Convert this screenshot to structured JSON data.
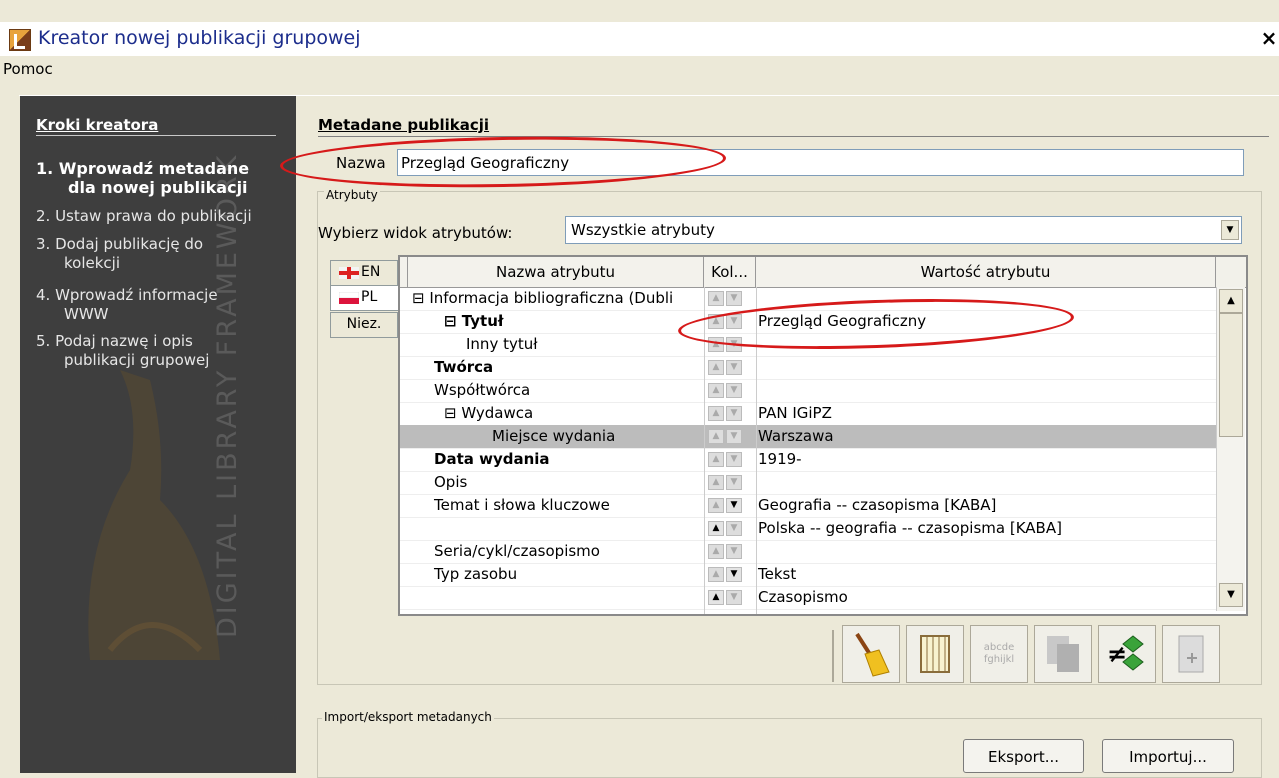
{
  "window": {
    "title": "Kreator nowej publikacji grupowej",
    "close_symbol": "×"
  },
  "menu": {
    "help": "Pomoc"
  },
  "sidebar": {
    "title": "Kroki kreatora",
    "steps": [
      {
        "line1": "1. Wprowadź metadane",
        "line2": "dla nowej publikacji"
      },
      {
        "line1": "2. Ustaw prawa do publikacji",
        "line2": ""
      },
      {
        "line1": "3. Dodaj publikację do",
        "line2": "kolekcji"
      },
      {
        "line1": "4. Wprowadź informacje",
        "line2": "WWW"
      },
      {
        "line1": "5. Podaj nazwę i opis",
        "line2": "publikacji grupowej"
      }
    ],
    "watermark": "DIGITAL LIBRARY FRAMEWORK"
  },
  "metadata": {
    "section_title": "Metadane publikacji",
    "name_label": "Nazwa",
    "name_value": "Przegląd Geograficzny",
    "attributes_legend": "Atrybuty",
    "view_label": "Wybierz widok atrybutów:",
    "view_value": "Wszystkie atrybuty"
  },
  "languages": [
    {
      "code": "EN",
      "selected": false
    },
    {
      "code": "PL",
      "selected": true
    },
    {
      "code": "Niez.",
      "selected": false
    }
  ],
  "table": {
    "headers": {
      "name": "Nazwa atrybutu",
      "order": "Kol...",
      "value": "Wartość atrybutu"
    },
    "rows": [
      {
        "name": "⊟ Informacja bibliograficzna (Dubli",
        "value": "",
        "bold": false,
        "up": false,
        "down": false
      },
      {
        "name": "⊟ Tytuł",
        "value": "Przegląd Geograficzny",
        "bold": true,
        "up": false,
        "down": false
      },
      {
        "name": "Inny tytuł",
        "value": "",
        "bold": false,
        "up": false,
        "down": false
      },
      {
        "name": "Twórca",
        "value": "",
        "bold": true,
        "up": false,
        "down": false
      },
      {
        "name": "Współtwórca",
        "value": "",
        "bold": false,
        "up": false,
        "down": false
      },
      {
        "name": "⊟ Wydawca",
        "value": "PAN IGiPZ",
        "bold": false,
        "up": false,
        "down": false
      },
      {
        "name": "Miejsce wydania",
        "value": "Warszawa",
        "bold": false,
        "up": false,
        "down": false
      },
      {
        "name": "Data wydania",
        "value": "1919-",
        "bold": true,
        "up": false,
        "down": false
      },
      {
        "name": "Opis",
        "value": "",
        "bold": false,
        "up": false,
        "down": false
      },
      {
        "name": "Temat i słowa kluczowe",
        "value": "Geografia -- czasopisma [KABA]",
        "bold": false,
        "up": false,
        "down": true
      },
      {
        "name": "",
        "value": "Polska -- geografia -- czasopisma [KABA]",
        "bold": false,
        "up": true,
        "down": false
      },
      {
        "name": "Seria/cykl/czasopismo",
        "value": "",
        "bold": false,
        "up": false,
        "down": false
      },
      {
        "name": "Typ zasobu",
        "value": "Tekst",
        "bold": false,
        "up": false,
        "down": true
      },
      {
        "name": "",
        "value": "Czasopismo",
        "bold": false,
        "up": true,
        "down": false
      }
    ]
  },
  "toolbar": {
    "text_tool_label": "abcde fghijkl"
  },
  "import_export": {
    "legend": "Import/eksport metadanych",
    "export_label": "Eksport...",
    "import_label": "Importuj..."
  },
  "colors": {
    "annotation": "#d61a1a",
    "sidebar_bg": "#3e3e3e",
    "title_text": "#1c2d8c"
  }
}
